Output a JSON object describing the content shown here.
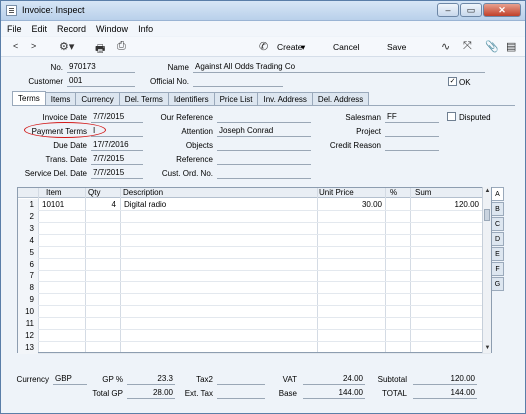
{
  "window": {
    "title": "Invoice: Inspect"
  },
  "menu": [
    "File",
    "Edit",
    "Record",
    "Window",
    "Info"
  ],
  "toolbar": {
    "create_label": "Create",
    "cancel_label": "Cancel",
    "save_label": "Save"
  },
  "header": {
    "no_label": "No.",
    "no_value": "970173",
    "name_label": "Name",
    "name_value": "Against All Odds Trading Co",
    "customer_label": "Customer",
    "customer_value": "001",
    "official_label": "Official No.",
    "official_value": "",
    "ok_label": "OK",
    "ok_checked": "✓"
  },
  "tabs": [
    "Terms",
    "Items",
    "Currency",
    "Del. Terms",
    "Identifiers",
    "Price List",
    "Inv. Address",
    "Del. Address"
  ],
  "terms": {
    "invoice_date_label": "Invoice Date",
    "invoice_date": "7/7/2015",
    "payment_terms_label": "Payment Terms",
    "payment_terms": "I",
    "due_date_label": "Due Date",
    "due_date": "17/7/2016",
    "trans_date_label": "Trans. Date",
    "trans_date": "7/7/2015",
    "service_del_date_label": "Service Del. Date",
    "service_del_date": "7/7/2015",
    "our_reference_label": "Our Reference",
    "our_reference": "",
    "attention_label": "Attention",
    "attention": "Joseph Conrad",
    "objects_label": "Objects",
    "objects": "",
    "reference_label": "Reference",
    "reference": "",
    "cust_ord_no_label": "Cust. Ord. No.",
    "cust_ord_no": "",
    "salesman_label": "Salesman",
    "salesman": "FF",
    "disputed_label": "Disputed",
    "project_label": "Project",
    "project": "",
    "credit_reason_label": "Credit Reason",
    "credit_reason": ""
  },
  "grid": {
    "columns": [
      "Item",
      "Qty",
      "Description",
      "Unit Price",
      "%",
      "Sum"
    ],
    "rows": [
      {
        "n": "1",
        "item": "10101",
        "qty": "4",
        "desc": "Digital radio",
        "price": "30.00",
        "pct": "",
        "sum": "120.00"
      },
      {
        "n": "2"
      },
      {
        "n": "3"
      },
      {
        "n": "4"
      },
      {
        "n": "5"
      },
      {
        "n": "6"
      },
      {
        "n": "7"
      },
      {
        "n": "8"
      },
      {
        "n": "9"
      },
      {
        "n": "10"
      },
      {
        "n": "11"
      },
      {
        "n": "12"
      },
      {
        "n": "13"
      }
    ],
    "side_tabs": [
      "A",
      "B",
      "C",
      "D",
      "E",
      "F",
      "G"
    ]
  },
  "footer": {
    "currency_label": "Currency",
    "currency": "GBP",
    "gp_pct_label": "GP %",
    "gp_pct": "23.3",
    "total_gp_label": "Total GP",
    "total_gp": "28.00",
    "tax2_label": "Tax2",
    "tax2": "",
    "ext_tax_label": "Ext. Tax",
    "ext_tax": "",
    "vat_label": "VAT",
    "vat": "24.00",
    "base_label": "Base",
    "base": "144.00",
    "subtotal_label": "Subtotal",
    "subtotal": "120.00",
    "total_label": "TOTAL",
    "total": "144.00"
  },
  "colors": {
    "highlight_oval": "#d21a1a"
  }
}
